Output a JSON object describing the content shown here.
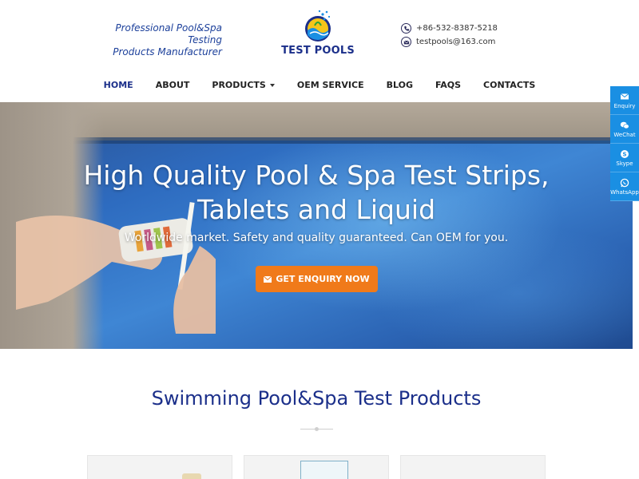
{
  "header": {
    "tagline_line1": "Professional Pool&Spa Testing",
    "tagline_line2": "Products Manufacturer",
    "logo_text": "TEST POOLS",
    "phone": "+86-532-8387-5218",
    "email": "testpools@163.com"
  },
  "nav": {
    "items": [
      {
        "label": "HOME",
        "active": true
      },
      {
        "label": "ABOUT"
      },
      {
        "label": "PRODUCTS",
        "dropdown": true
      },
      {
        "label": "OEM SERVICE"
      },
      {
        "label": "BLOG"
      },
      {
        "label": "FAQS"
      },
      {
        "label": "CONTACTS"
      }
    ]
  },
  "hero": {
    "title_line1": "High Quality Pool & Spa Test Strips,",
    "title_line2": "Tablets and Liquid",
    "subtitle": "Worldwide market. Safety and quality guaranteed. Can OEM for you.",
    "cta_label": "GET ENQUIRY NOW"
  },
  "sidebar": {
    "items": [
      {
        "label": "Enquiry",
        "icon": "envelope-icon"
      },
      {
        "label": "WeChat",
        "icon": "wechat-icon"
      },
      {
        "label": "Skype",
        "icon": "skype-icon"
      },
      {
        "label": "WhatsApp",
        "icon": "whatsapp-icon"
      }
    ]
  },
  "section": {
    "title": "Swimming Pool&Spa Test Products"
  },
  "colors": {
    "brand_blue": "#1b2f8a",
    "accent_orange": "#f07a1a",
    "sidebar_blue": "#1a8fe3"
  }
}
